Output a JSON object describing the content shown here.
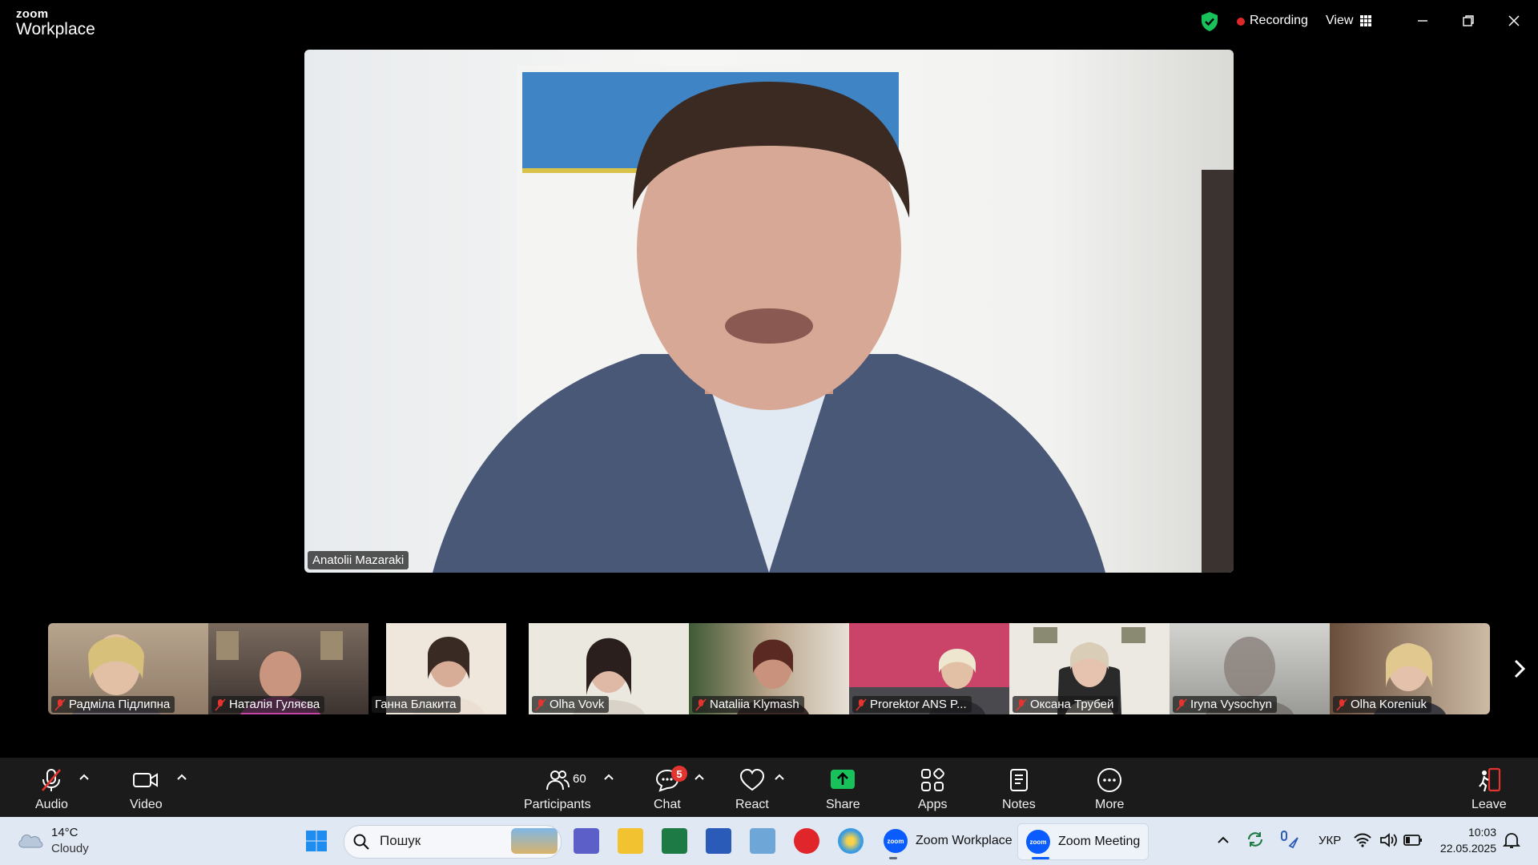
{
  "app": {
    "logo_top": "zoom",
    "logo_bottom": "Workplace"
  },
  "titlebar": {
    "recording_label": "Recording",
    "view_label": "View"
  },
  "main_speaker": {
    "name": "Anatolii Mazaraki"
  },
  "participants": [
    {
      "name": "Радміла Підлипна",
      "muted": true
    },
    {
      "name": "Наталія Гуляєва",
      "muted": true
    },
    {
      "name": "Ганна Блакита",
      "muted": false
    },
    {
      "name": "Olha Vovk",
      "muted": true
    },
    {
      "name": "Nataliia Klymash",
      "muted": true
    },
    {
      "name": "Prorektor ANS P...",
      "muted": true
    },
    {
      "name": "Оксана Трубей",
      "muted": true
    },
    {
      "name": "Iryna Vysochyn",
      "muted": true
    },
    {
      "name": "Olha Koreniuk",
      "muted": true
    }
  ],
  "toolbar": {
    "audio": "Audio",
    "video": "Video",
    "participants": "Participants",
    "participants_count": "60",
    "chat": "Chat",
    "chat_badge": "5",
    "react": "React",
    "share": "Share",
    "apps": "Apps",
    "notes": "Notes",
    "more": "More",
    "leave": "Leave"
  },
  "taskbar": {
    "weather_temp": "14°C",
    "weather_condition": "Cloudy",
    "search_placeholder": "Пошук",
    "zoom_workplace": "Zoom Workplace",
    "zoom_meeting": "Zoom Meeting",
    "language": "УКР",
    "time": "10:03",
    "date": "22.05.2025"
  },
  "colors": {
    "accent": "#0b5cff",
    "recording": "#e02828",
    "share": "#19c15b",
    "leave": "#e3342f",
    "badge": "#e3342f"
  }
}
